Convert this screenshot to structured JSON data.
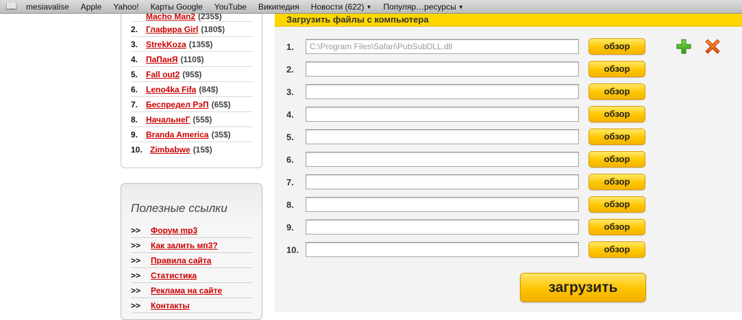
{
  "bookmarks_bar": {
    "book_icon": "open-book-icon",
    "items": [
      {
        "label": "mesiavalise",
        "menu": false
      },
      {
        "label": "Apple",
        "menu": false
      },
      {
        "label": "Yahoo!",
        "menu": false
      },
      {
        "label": "Карты Google",
        "menu": false
      },
      {
        "label": "YouTube",
        "menu": false
      },
      {
        "label": "Википедия",
        "menu": false
      },
      {
        "label": "Новости (622)",
        "menu": true
      },
      {
        "label": "Популяр…ресурсы",
        "menu": true
      }
    ]
  },
  "top_list": {
    "items": [
      {
        "num": "",
        "name": "Macho Man2",
        "amount": "(235$)"
      },
      {
        "num": "2.",
        "name": "Глафира Girl",
        "amount": "(180$)"
      },
      {
        "num": "3.",
        "name": "StrekKoza",
        "amount": "(135$)"
      },
      {
        "num": "4.",
        "name": "ПаПанЯ",
        "amount": "(110$)"
      },
      {
        "num": "5.",
        "name": "Fall out2",
        "amount": "(95$)"
      },
      {
        "num": "6.",
        "name": "Leno4ka Fifa",
        "amount": "(84$)"
      },
      {
        "num": "7.",
        "name": "Беспредел РэП",
        "amount": "(65$)"
      },
      {
        "num": "8.",
        "name": "НачальнеГ",
        "amount": "(55$)"
      },
      {
        "num": "9.",
        "name": "Branda America",
        "amount": "(35$)"
      },
      {
        "num": "10.",
        "name": "Zimbabwe",
        "amount": "(15$)"
      }
    ]
  },
  "useful_links": {
    "title": "Полезные ссылки",
    "prefix": ">>",
    "items": [
      "Форум mp3",
      "Как залить мп3?",
      "Правила сайта",
      "Статистика",
      "Реклама на сайте",
      "Контакты"
    ]
  },
  "upload_panel": {
    "title": "Загрузить файлы с компьютера",
    "browse_label": "обзор",
    "rows": [
      {
        "num": "1.",
        "value": "C:\\Program Files\\Safari\\PubSubDLL.dll"
      },
      {
        "num": "2.",
        "value": ""
      },
      {
        "num": "3.",
        "value": ""
      },
      {
        "num": "4.",
        "value": ""
      },
      {
        "num": "5.",
        "value": ""
      },
      {
        "num": "6.",
        "value": ""
      },
      {
        "num": "7.",
        "value": ""
      },
      {
        "num": "8.",
        "value": ""
      },
      {
        "num": "9.",
        "value": ""
      },
      {
        "num": "10.",
        "value": ""
      }
    ],
    "add_icon": "plus-icon",
    "remove_icon": "close-icon",
    "submit_label": "загрузить"
  },
  "colors": {
    "accent_yellow": "#ffd700",
    "link_red": "#cc0000",
    "plus_green": "#3cae16",
    "close_orange": "#ee5a10"
  }
}
